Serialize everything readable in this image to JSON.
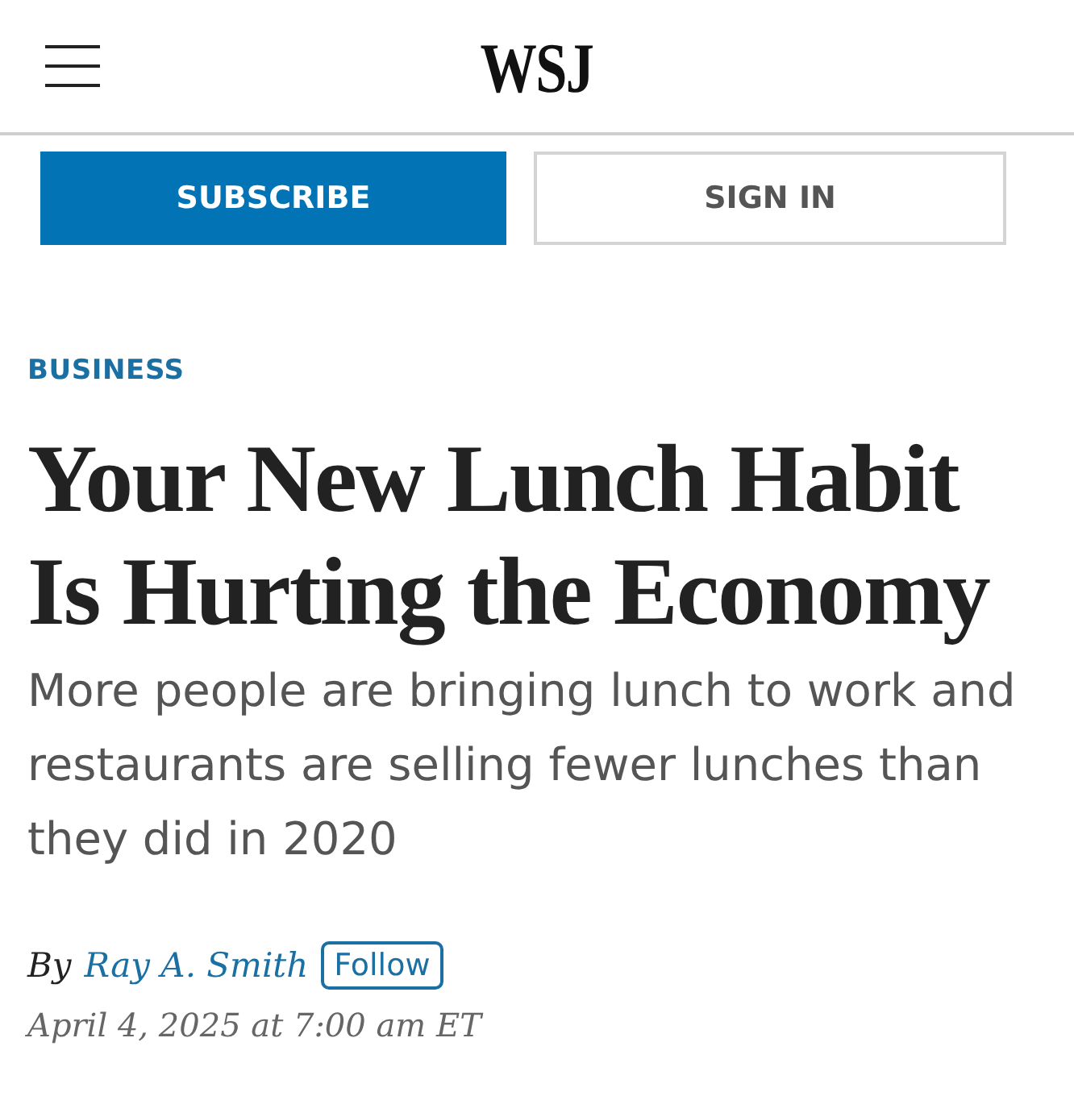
{
  "header": {
    "logo": "WSJ"
  },
  "account_buttons": [
    {
      "label": "SUBSCRIBE",
      "kind": "primary"
    },
    {
      "label": "SIGN IN",
      "kind": "secondary"
    }
  ],
  "article": {
    "section": "BUSINESS",
    "headline": "Your New Lunch Habit Is Hurting the Economy",
    "dek": "More people are bringing lunch to work and restaurants are selling fewer lunches than they did in 2020",
    "byline": {
      "prefix": "By",
      "author": "Ray A. Smith",
      "follow_label": "Follow"
    },
    "timestamp": "April 4, 2025 at 7:00 am ET"
  }
}
